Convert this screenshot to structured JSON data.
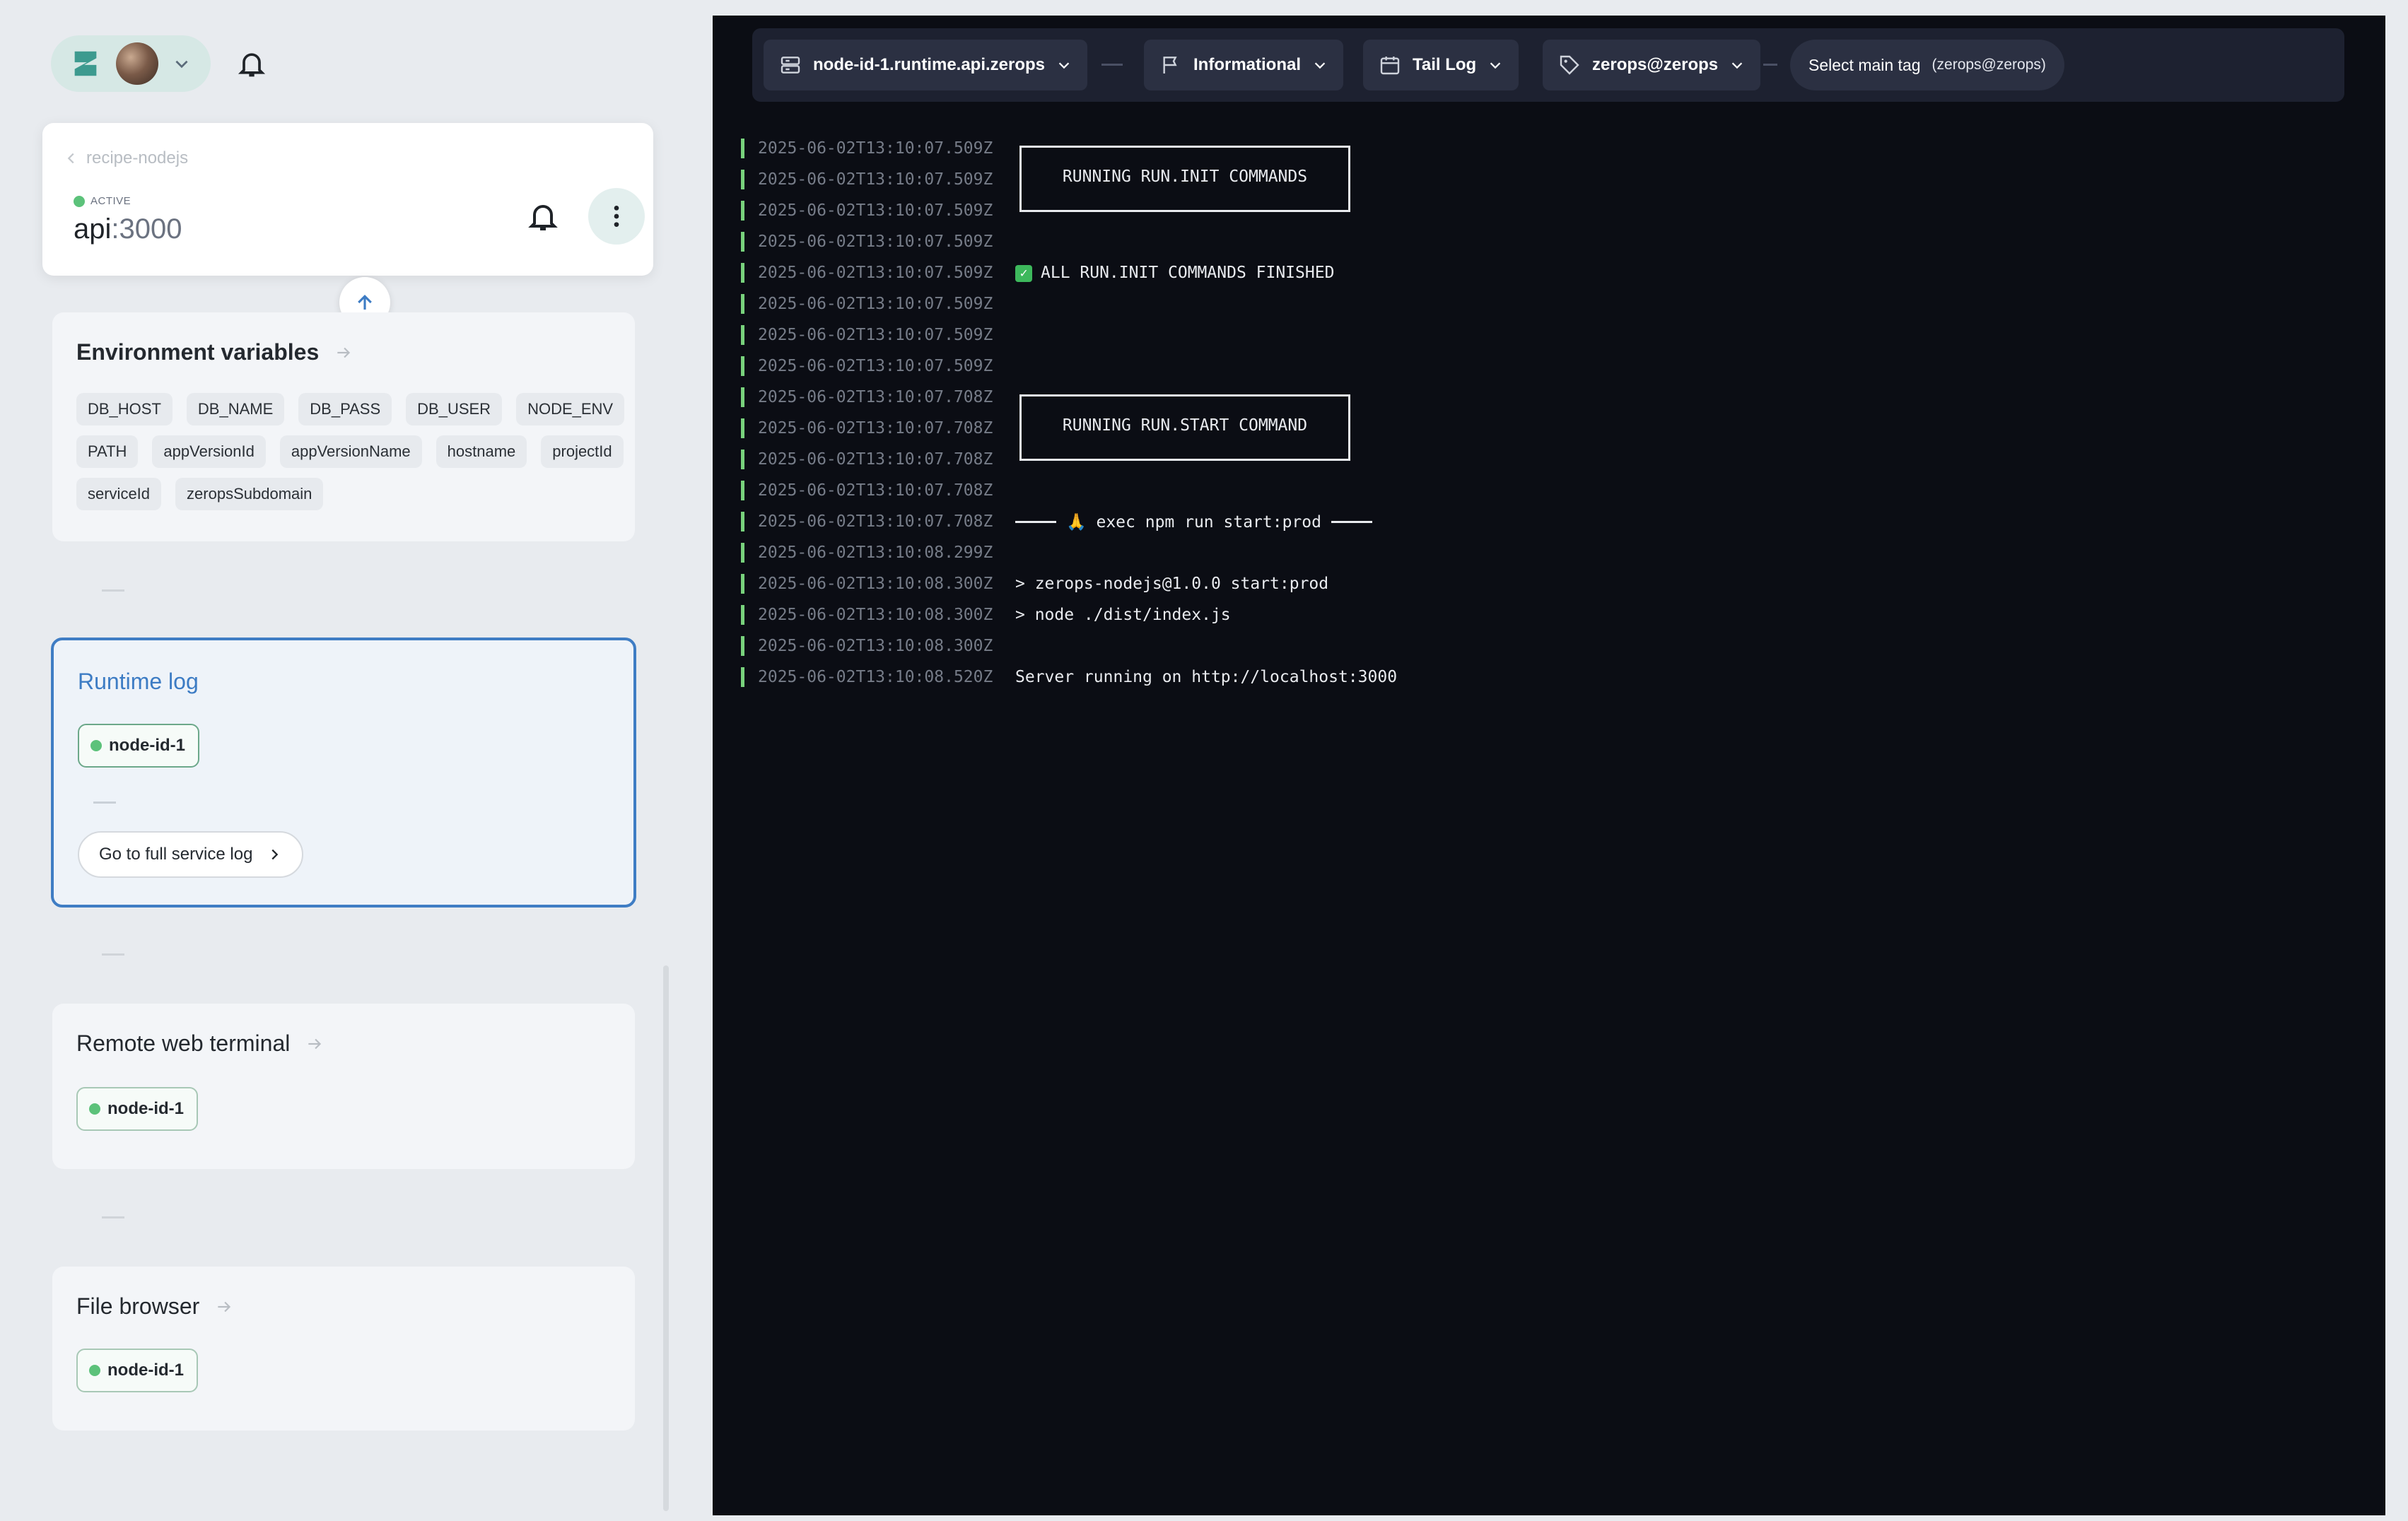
{
  "sidebar": {
    "breadcrumb": "recipe-nodejs",
    "status": "ACTIVE",
    "service_name": "api",
    "service_port": ":3000",
    "env": {
      "title": "Environment variables",
      "vars": [
        "DB_HOST",
        "DB_NAME",
        "DB_PASS",
        "DB_USER",
        "NODE_ENV",
        "PATH",
        "appVersionId",
        "appVersionName",
        "hostname",
        "projectId",
        "serviceId",
        "zeropsSubdomain"
      ]
    },
    "runtime_log": {
      "title": "Runtime log",
      "node": "node-id-1",
      "full_log_label": "Go to full service log"
    },
    "terminal": {
      "title": "Remote web terminal",
      "node": "node-id-1"
    },
    "file_browser": {
      "title": "File browser",
      "node": "node-id-1"
    }
  },
  "filters": {
    "container": "node-id-1.runtime.api.zerops",
    "severity": "Informational",
    "mode": "Tail Log",
    "tag": "zerops@zerops",
    "main_tag_label": "Select main tag",
    "main_tag_value": "(zerops@zerops)"
  },
  "log": [
    {
      "ts": "2025-06-02T13:10:07.509Z",
      "msg": ""
    },
    {
      "ts": "2025-06-02T13:10:07.509Z",
      "msg": ""
    },
    {
      "ts": "2025-06-02T13:10:07.509Z",
      "msg": ""
    },
    {
      "ts": "2025-06-02T13:10:07.509Z",
      "msg": ""
    },
    {
      "ts": "2025-06-02T13:10:07.509Z",
      "msg": "ALL RUN.INIT COMMANDS FINISHED"
    },
    {
      "ts": "2025-06-02T13:10:07.509Z",
      "msg": ""
    },
    {
      "ts": "2025-06-02T13:10:07.509Z",
      "msg": ""
    },
    {
      "ts": "2025-06-02T13:10:07.509Z",
      "msg": ""
    },
    {
      "ts": "2025-06-02T13:10:07.708Z",
      "msg": ""
    },
    {
      "ts": "2025-06-02T13:10:07.708Z",
      "msg": ""
    },
    {
      "ts": "2025-06-02T13:10:07.708Z",
      "msg": ""
    },
    {
      "ts": "2025-06-02T13:10:07.708Z",
      "msg": ""
    },
    {
      "ts": "2025-06-02T13:10:07.708Z",
      "msg": "🙏 exec npm run start:prod"
    },
    {
      "ts": "2025-06-02T13:10:08.299Z",
      "msg": ""
    },
    {
      "ts": "2025-06-02T13:10:08.300Z",
      "msg": "> zerops-nodejs@1.0.0 start:prod"
    },
    {
      "ts": "2025-06-02T13:10:08.300Z",
      "msg": "> node ./dist/index.js"
    },
    {
      "ts": "2025-06-02T13:10:08.300Z",
      "msg": ""
    },
    {
      "ts": "2025-06-02T13:10:08.520Z",
      "msg": "Server running on http://localhost:3000"
    }
  ],
  "log_boxes": {
    "init": "RUNNING RUN.INIT COMMANDS",
    "start": "RUNNING RUN.START COMMAND"
  },
  "colors": {
    "accent": "#3d7cc4",
    "active": "#5cc27a",
    "terminal_bg": "#0b0d14"
  }
}
